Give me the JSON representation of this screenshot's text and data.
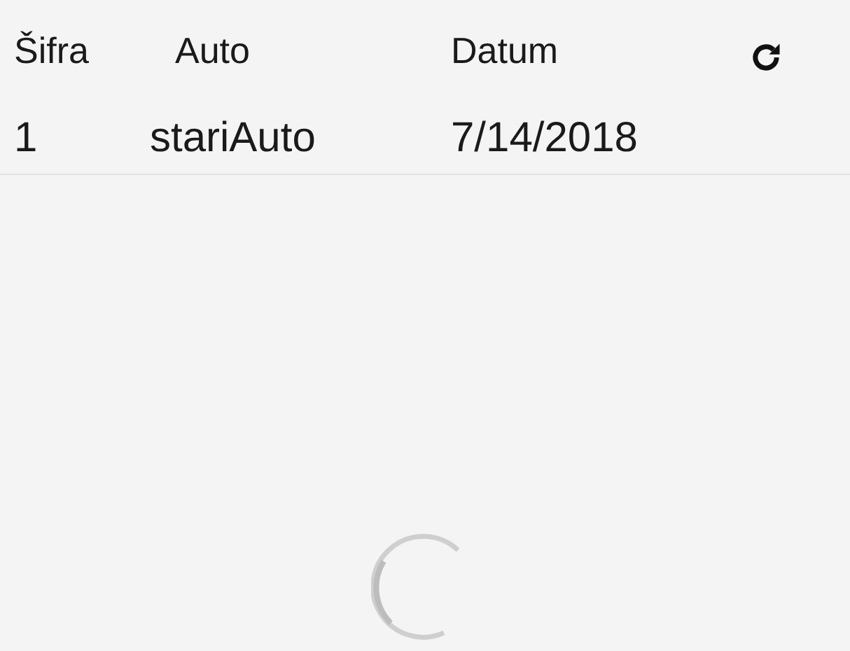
{
  "table": {
    "columns": [
      {
        "label": "Šifra"
      },
      {
        "label": "Auto"
      },
      {
        "label": "Datum"
      }
    ],
    "rows": [
      {
        "cells": [
          "1",
          "stariAuto",
          "7/14/2018"
        ]
      }
    ]
  },
  "loading": true
}
